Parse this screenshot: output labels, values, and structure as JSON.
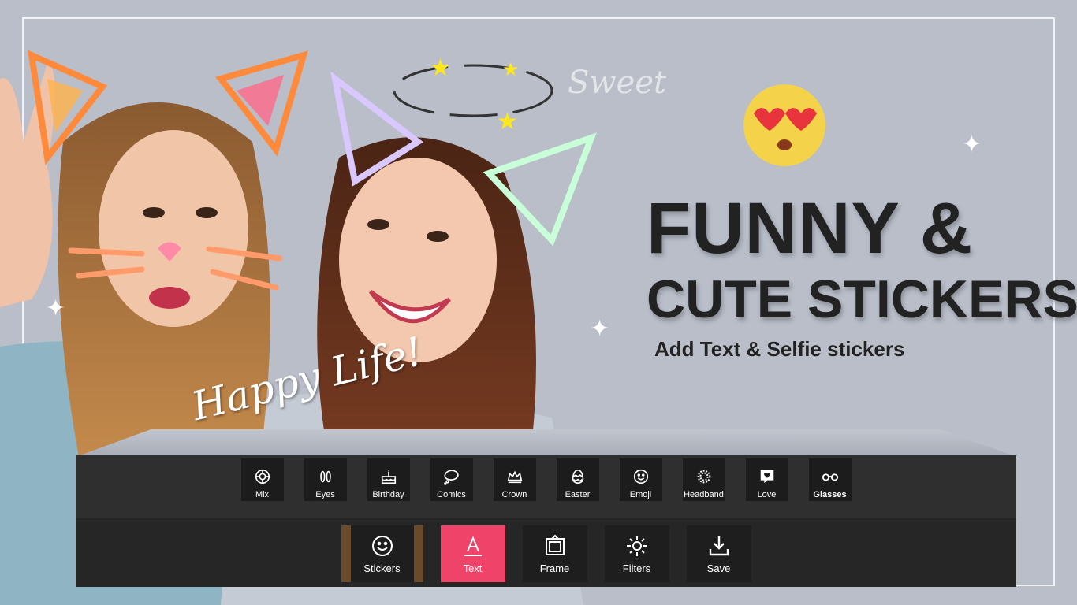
{
  "headline": {
    "line1": "FUNNY &",
    "line2": "CUTE STICKERS",
    "subtitle": "Add Text & Selfie stickers"
  },
  "overlay_text": {
    "sweet": "Sweet",
    "happy_life": "Happy Life!"
  },
  "categories": [
    {
      "label": "Mix",
      "icon": "mix-icon"
    },
    {
      "label": "Eyes",
      "icon": "eyes-icon"
    },
    {
      "label": "Birthday",
      "icon": "cake-icon"
    },
    {
      "label": "Comics",
      "icon": "speech-bubble-icon"
    },
    {
      "label": "Crown",
      "icon": "crown-icon"
    },
    {
      "label": "Easter",
      "icon": "egg-icon"
    },
    {
      "label": "Emoji",
      "icon": "smiley-icon"
    },
    {
      "label": "Headband",
      "icon": "wreath-icon"
    },
    {
      "label": "Love",
      "icon": "heart-bubble-icon"
    },
    {
      "label": "Glasses",
      "icon": "glasses-icon"
    }
  ],
  "tools": [
    {
      "label": "Stickers",
      "icon": "smiley-icon"
    },
    {
      "label": "Text",
      "icon": "text-icon"
    },
    {
      "label": "Frame",
      "icon": "frame-icon"
    },
    {
      "label": "Filters",
      "icon": "sun-icon"
    },
    {
      "label": "Save",
      "icon": "download-icon"
    }
  ],
  "colors": {
    "accent": "#f0436a",
    "background": "#b9bec9",
    "toolbar_dark": "#2f2f2f"
  }
}
